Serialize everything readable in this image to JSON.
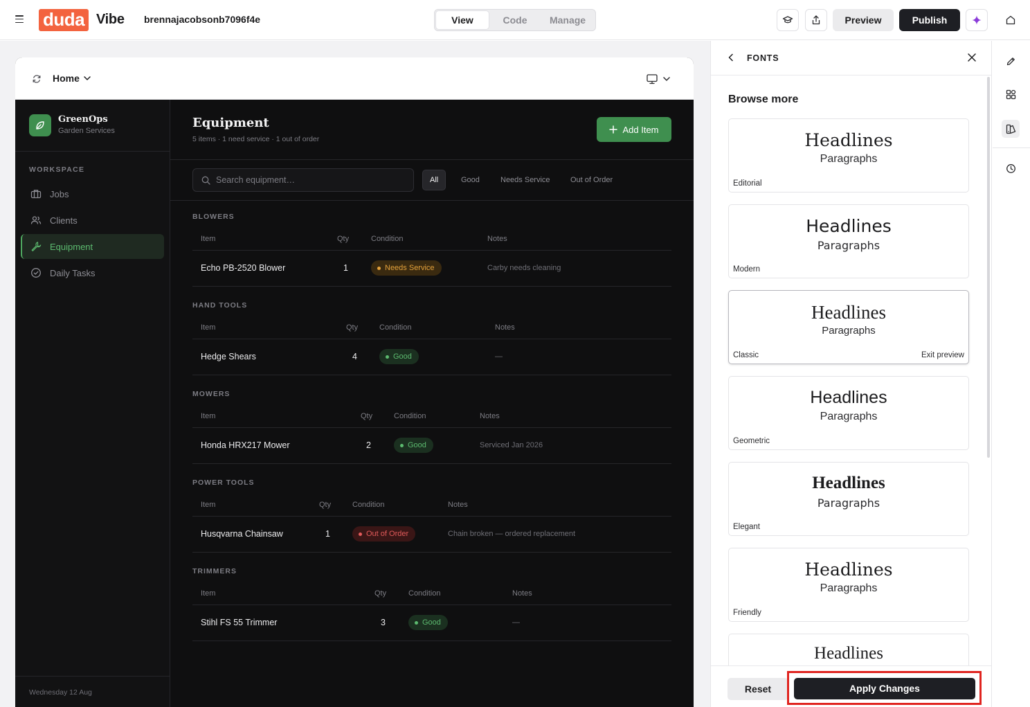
{
  "topbar": {
    "logo_text": "duda",
    "product": "Vibe",
    "site_name": "brennajacobsonb7096f4e",
    "tabs": [
      {
        "label": "View",
        "active": true
      },
      {
        "label": "Code",
        "active": false
      },
      {
        "label": "Manage",
        "active": false
      }
    ],
    "preview_label": "Preview",
    "publish_label": "Publish",
    "accent": "#f3633f",
    "icons": [
      "menu-icon",
      "graduation-cap-icon",
      "share-icon",
      "sparkle-icon",
      "home-icon"
    ]
  },
  "frame": {
    "page_selector": "Home"
  },
  "app": {
    "brand": {
      "name": "GreenOps",
      "subtitle": "Garden Services"
    },
    "workspace_label": "WORKSPACE",
    "nav": [
      {
        "label": "Jobs",
        "icon": "briefcase-icon",
        "active": false
      },
      {
        "label": "Clients",
        "icon": "users-icon",
        "active": false
      },
      {
        "label": "Equipment",
        "icon": "wrench-icon",
        "active": true
      },
      {
        "label": "Daily Tasks",
        "icon": "check-circle-icon",
        "active": false
      }
    ],
    "date": "Wednesday 12 Aug",
    "title": "Equipment",
    "summary": "5 items · 1 need service · 1 out of order",
    "add_button": "Add Item",
    "search_placeholder": "Search equipment…",
    "filters": [
      {
        "label": "All",
        "active": true
      },
      {
        "label": "Good",
        "active": false
      },
      {
        "label": "Needs Service",
        "active": false
      },
      {
        "label": "Out of Order",
        "active": false
      }
    ],
    "columns": {
      "item": "Item",
      "qty": "Qty",
      "condition": "Condition",
      "notes": "Notes"
    },
    "groups": [
      {
        "label": "BLOWERS",
        "rows": [
          {
            "item": "Echo PB-2520 Blower",
            "qty": "1",
            "condition": "Needs Service",
            "status": "warn",
            "notes": "Carby needs cleaning"
          }
        ]
      },
      {
        "label": "HAND TOOLS",
        "rows": [
          {
            "item": "Hedge Shears",
            "qty": "4",
            "condition": "Good",
            "status": "good",
            "notes": "—"
          }
        ]
      },
      {
        "label": "MOWERS",
        "rows": [
          {
            "item": "Honda HRX217 Mower",
            "qty": "2",
            "condition": "Good",
            "status": "good",
            "notes": "Serviced Jan 2026"
          }
        ]
      },
      {
        "label": "POWER TOOLS",
        "rows": [
          {
            "item": "Husqvarna Chainsaw",
            "qty": "1",
            "condition": "Out of Order",
            "status": "bad",
            "notes": "Chain broken — ordered replacement"
          }
        ]
      },
      {
        "label": "TRIMMERS",
        "rows": [
          {
            "item": "Stihl FS 55 Trimmer",
            "qty": "3",
            "condition": "Good",
            "status": "good",
            "notes": "—"
          }
        ]
      }
    ],
    "status_colors": {
      "good": "#5cba6f",
      "warn": "#e5a23b",
      "bad": "#e35b5b",
      "accent": "#3f8f4f"
    }
  },
  "panel": {
    "title": "FONTS",
    "browse_label": "Browse more",
    "cards": [
      {
        "headline": "Headlines",
        "paragraph": "Paragraphs",
        "name": "Editorial",
        "selected": false
      },
      {
        "headline": "Headlines",
        "paragraph": "Paragraphs",
        "name": "Modern",
        "selected": false
      },
      {
        "headline": "Headlines",
        "paragraph": "Paragraphs",
        "name": "Classic",
        "selected": true,
        "exit_label": "Exit preview"
      },
      {
        "headline": "Headlines",
        "paragraph": "Paragraphs",
        "name": "Geometric",
        "selected": false
      },
      {
        "headline": "Headlines",
        "paragraph": "Paragraphs",
        "name": "Elegant",
        "selected": false
      },
      {
        "headline": "Headlines",
        "paragraph": "Paragraphs",
        "name": "Friendly",
        "selected": false
      },
      {
        "headline": "Headlines",
        "paragraph": "",
        "name": "",
        "selected": false
      }
    ],
    "reset_label": "Reset",
    "apply_label": "Apply Changes"
  },
  "rail": {
    "icons": [
      "pencil-icon",
      "components-icon",
      "styles-icon",
      "history-icon"
    ]
  }
}
